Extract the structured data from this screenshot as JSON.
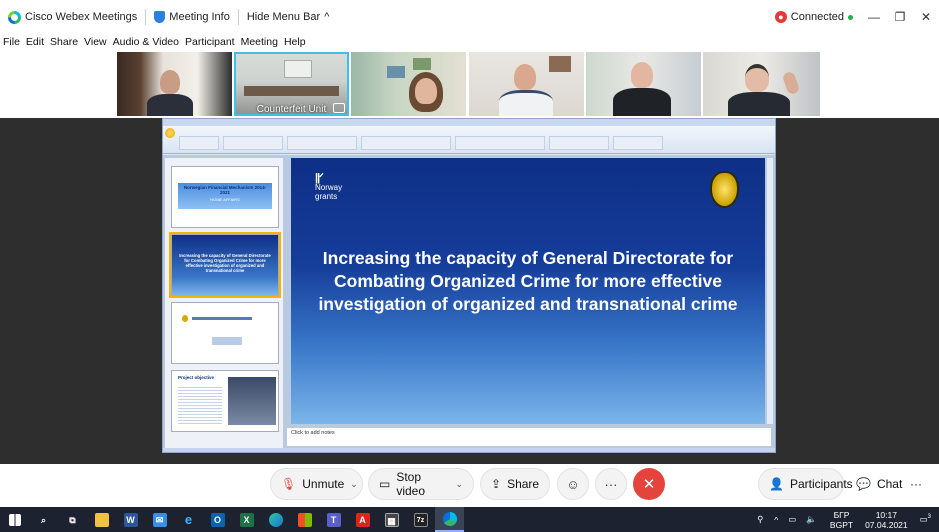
{
  "titlebar": {
    "app_name": "Cisco Webex Meetings",
    "meeting_info": "Meeting Info",
    "hide_menu": "Hide Menu Bar",
    "status": "Connected"
  },
  "menu": [
    "File",
    "Edit",
    "Share",
    "View",
    "Audio & Video",
    "Participant",
    "Meeting",
    "Help"
  ],
  "thumbnails": {
    "active_label": "Counterfeit Unit"
  },
  "slide": {
    "brand_line1": "Norway",
    "brand_line2": "grants",
    "title": "Increasing the capacity of General Directorate for Combating Organized Crime for more effective investigation of organized and transnational crime",
    "notes_placeholder": "Click to add notes"
  },
  "slide_panel": [
    {
      "title": "Norwegian Financial Mechanism 2014-2021",
      "subtitle": "HOME AFFAIRS"
    },
    {
      "title": "Increasing the capacity of General Directorate for Combating Organized Crime for more effective investigation of organized and transnational crime"
    },
    {
      "title": ""
    },
    {
      "title": "Project objective"
    }
  ],
  "controls": {
    "unmute": "Unmute",
    "stop_video": "Stop video",
    "share": "Share",
    "participants": "Participants",
    "chat": "Chat",
    "more": "···"
  },
  "taskbar": {
    "lang_line1": "БГР",
    "lang_line2": "BGPT",
    "time": "10:17",
    "date": "07.04.2021",
    "notifications": "3"
  },
  "colors": {
    "end_button": "#e5443d",
    "active_thumb_border": "#3ec1e6",
    "connected_dot": "#1cb34b"
  }
}
